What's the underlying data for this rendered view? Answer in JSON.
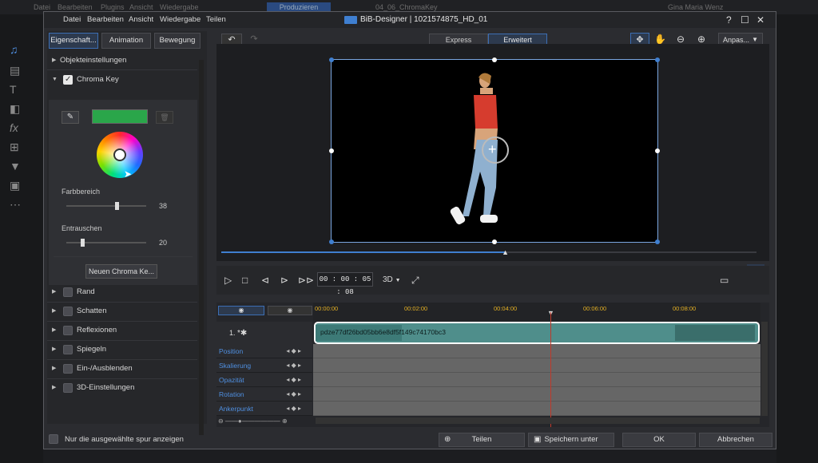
{
  "background_app": {
    "menu": [
      "Datei",
      "Bearbeiten",
      "Plugins",
      "Ansicht",
      "Wiedergabe"
    ],
    "produce_button": "Produzieren",
    "project_name": "04_06_ChromaKey",
    "user_name": "Gina Maria Wenz"
  },
  "dialog": {
    "menu": [
      "Datei",
      "Bearbeiten",
      "Ansicht",
      "Wiedergabe",
      "Teilen"
    ],
    "title": "BiB-Designer  |  1021574875_HD_01",
    "help": "?",
    "maximize": "☐",
    "close": "✕"
  },
  "left_panel": {
    "tabs": [
      "Eigenschaft...",
      "Animation",
      "Bewegung"
    ],
    "sections": {
      "objekt": "Objekteinstellungen",
      "chroma": "Chroma Key",
      "rand": "Rand",
      "schatten": "Schatten",
      "reflexionen": "Reflexionen",
      "spiegeln": "Spiegeln",
      "einaus": "Ein-/Ausblenden",
      "dreid": "3D-Einstellungen"
    },
    "chroma_key": {
      "key_color": "#2aa64a",
      "farbbereich_label": "Farbbereich",
      "farbbereich_value": "38",
      "farbbereich_fraction": 0.63,
      "entrauschen_label": "Entrauschen",
      "entrauschen_value": "20",
      "entrauschen_fraction": 0.2,
      "new_button": "Neuen Chroma Ke..."
    }
  },
  "toolbar": {
    "mode_express": "Express",
    "mode_advanced": "Erweitert",
    "zoom_dropdown": "Anpas..."
  },
  "playback": {
    "timecode": "00 : 00 : 05 : 08",
    "mode_3d": "3D",
    "progress_fraction": 0.53
  },
  "timeline": {
    "ticks": [
      "00:00:00",
      "00:02:00",
      "00:04:00",
      "00:06:00",
      "00:08:00"
    ],
    "track_label": "1.",
    "clip_name": "pdze77df26bd05bb6e8df5f149c74170bc3",
    "keyframe_rows": [
      "Position",
      "Skalierung",
      "Opazität",
      "Rotation",
      "Ankerpunkt"
    ]
  },
  "footer": {
    "only_selected": "Nur die ausgewählte spur anzeigen",
    "share": "Teilen",
    "save_as": "Speichern unter",
    "ok": "OK",
    "cancel": "Abbrechen"
  },
  "colors": {
    "accent": "#3f7fd0",
    "clip": "#4f8e8b",
    "timecode_ticks": "#e3b024"
  }
}
